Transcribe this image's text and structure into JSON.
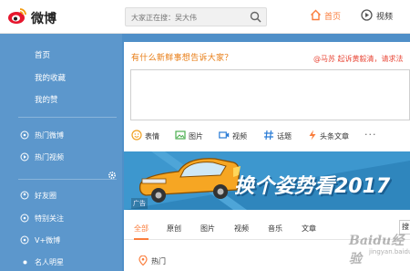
{
  "header": {
    "logo_text": "微博",
    "search": {
      "placeholder": "大家正在搜：吴大伟"
    },
    "nav": {
      "home": "首页",
      "video": "视频"
    }
  },
  "sidebar": {
    "items": [
      "首页",
      "我的收藏",
      "我的赞",
      "热门微博",
      "热门视频",
      "好友圈",
      "特别关注",
      "V+微博",
      "名人明星"
    ]
  },
  "composer": {
    "prompt": "有什么新鲜事想告诉大家？",
    "hot_topic": "@马苏 起诉黄毅清，请求法"
  },
  "toolbar": {
    "items": [
      "表情",
      "图片",
      "视频",
      "话题",
      "头条文章"
    ],
    "more": "···"
  },
  "banner": {
    "ad_label": "广告",
    "headline": "换个姿势看2017"
  },
  "feed_tabs": {
    "items": [
      "全部",
      "原创",
      "图片",
      "视频",
      "音乐",
      "文章"
    ],
    "active": "全部",
    "search_label": "搜"
  },
  "feed": {
    "first_section": "热门"
  },
  "watermark": {
    "brand": "Baidu经验",
    "url": "jingyan.baidu.com"
  },
  "colors": {
    "accent": "#fa7d3c",
    "sidebar_bg": "#4f8fc8",
    "banner_bg": "#3d97ce",
    "hot_topic": "#e94a3a"
  }
}
